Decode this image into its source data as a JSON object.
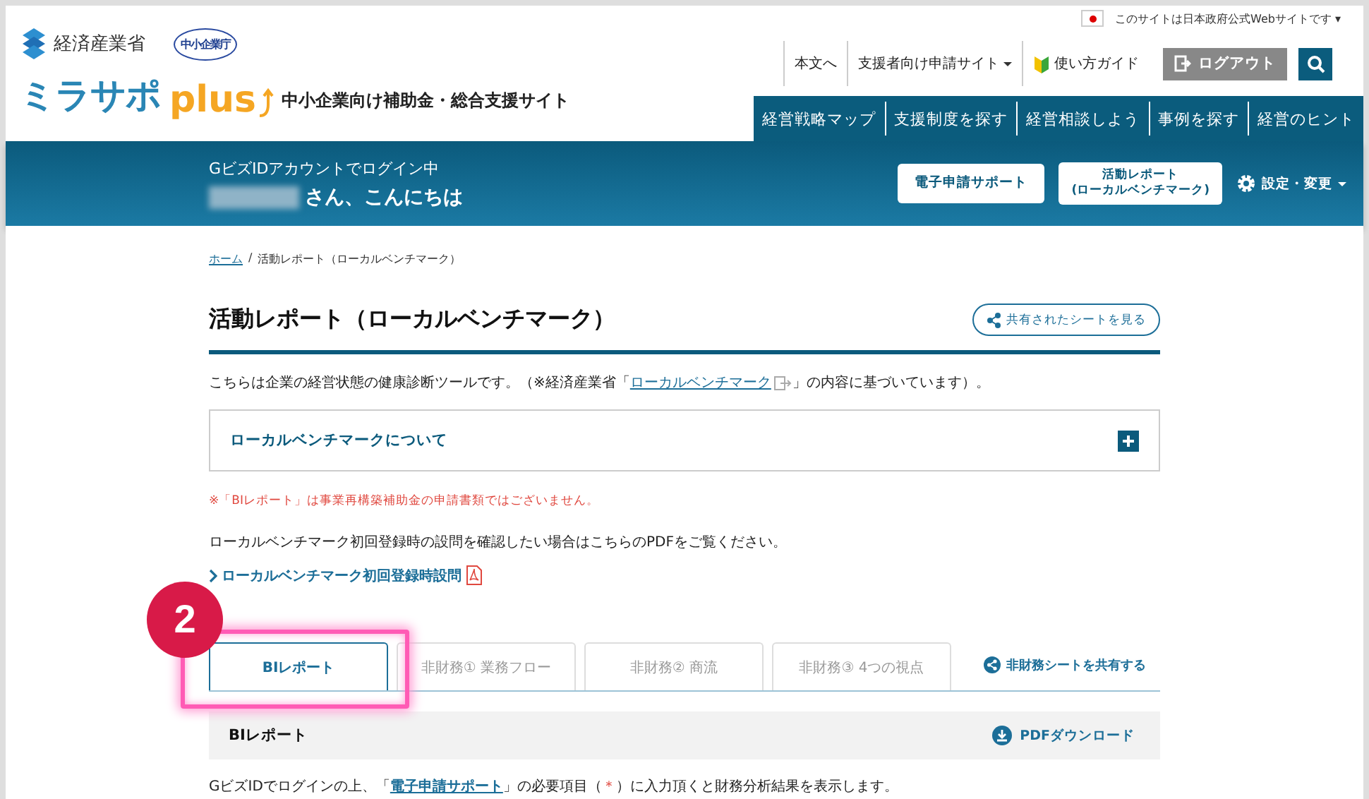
{
  "gov_banner": {
    "text": "このサイトは日本政府公式Webサイトです",
    "caret": "▾"
  },
  "header": {
    "ministry": "経済産業省",
    "agency": "中小企業庁",
    "brand": "ミラサポ",
    "brand_suffix": "plus",
    "tagline": "中小企業向け補助金・総合支援サイト",
    "utility_links": [
      {
        "label": "本文へ",
        "kind": "plain"
      },
      {
        "label": "支援者向け申請サイト",
        "kind": "dropdown"
      },
      {
        "label": "使い方ガイド",
        "kind": "guide"
      }
    ],
    "logout": "ログアウト",
    "nav": [
      "経営戦略マップ",
      "支援制度を探す",
      "経営相談しよう",
      "事例を探す",
      "経営のヒント"
    ]
  },
  "user_band": {
    "login_status": "GビズIDアカウントでログイン中",
    "greeting": "さん、こんにちは",
    "buttons": [
      {
        "lines": [
          "電子申請サポート"
        ]
      },
      {
        "lines": [
          "活動レポート",
          "(ローカルベンチマーク)"
        ]
      }
    ],
    "settings": "設定・変更"
  },
  "breadcrumb_separator": "/",
  "breadcrumb": [
    {
      "label": "ホーム",
      "kind": "link"
    },
    {
      "label": "活動レポート（ローカルベンチマーク）",
      "kind": "current"
    }
  ],
  "page_title": "活動レポート（ローカルベンチマーク）",
  "shared_sheets_button": "共有されたシートを見る",
  "intro": {
    "before": "こちらは企業の経営状態の健康診断ツールです。（※経済産業省「",
    "link": "ローカルベンチマーク",
    "after": "」の内容に基づいています）。"
  },
  "accordion": {
    "label": "ローカルベンチマークについて",
    "expanded": false
  },
  "notice": "※「BIレポート」は事業再構築補助金の申請書類ではございません。",
  "pdf_note": "ローカルベンチマーク初回登録時の設問を確認したい場合はこちらのPDFをご覧ください。",
  "pdf_link": "ローカルベンチマーク初回登録時設問",
  "callout": "2",
  "tabs": {
    "items": [
      {
        "label": "BIレポート",
        "selected": true
      },
      {
        "label": "非財務① 業務フロー",
        "selected": false
      },
      {
        "label": "非財務② 商流",
        "selected": false
      },
      {
        "label": "非財務③ 4つの視点",
        "selected": false
      }
    ],
    "share_link": "非財務シートを共有する"
  },
  "section": {
    "title": "BIレポート",
    "download": "PDFダウンロード"
  },
  "body_text": {
    "before": "GビズIDでログインの上、「",
    "link": "電子申請サポート",
    "middle": "」の必要項目（",
    "mark": "＊",
    "after": "）に入力頂くと財務分析結果を表示します。"
  }
}
